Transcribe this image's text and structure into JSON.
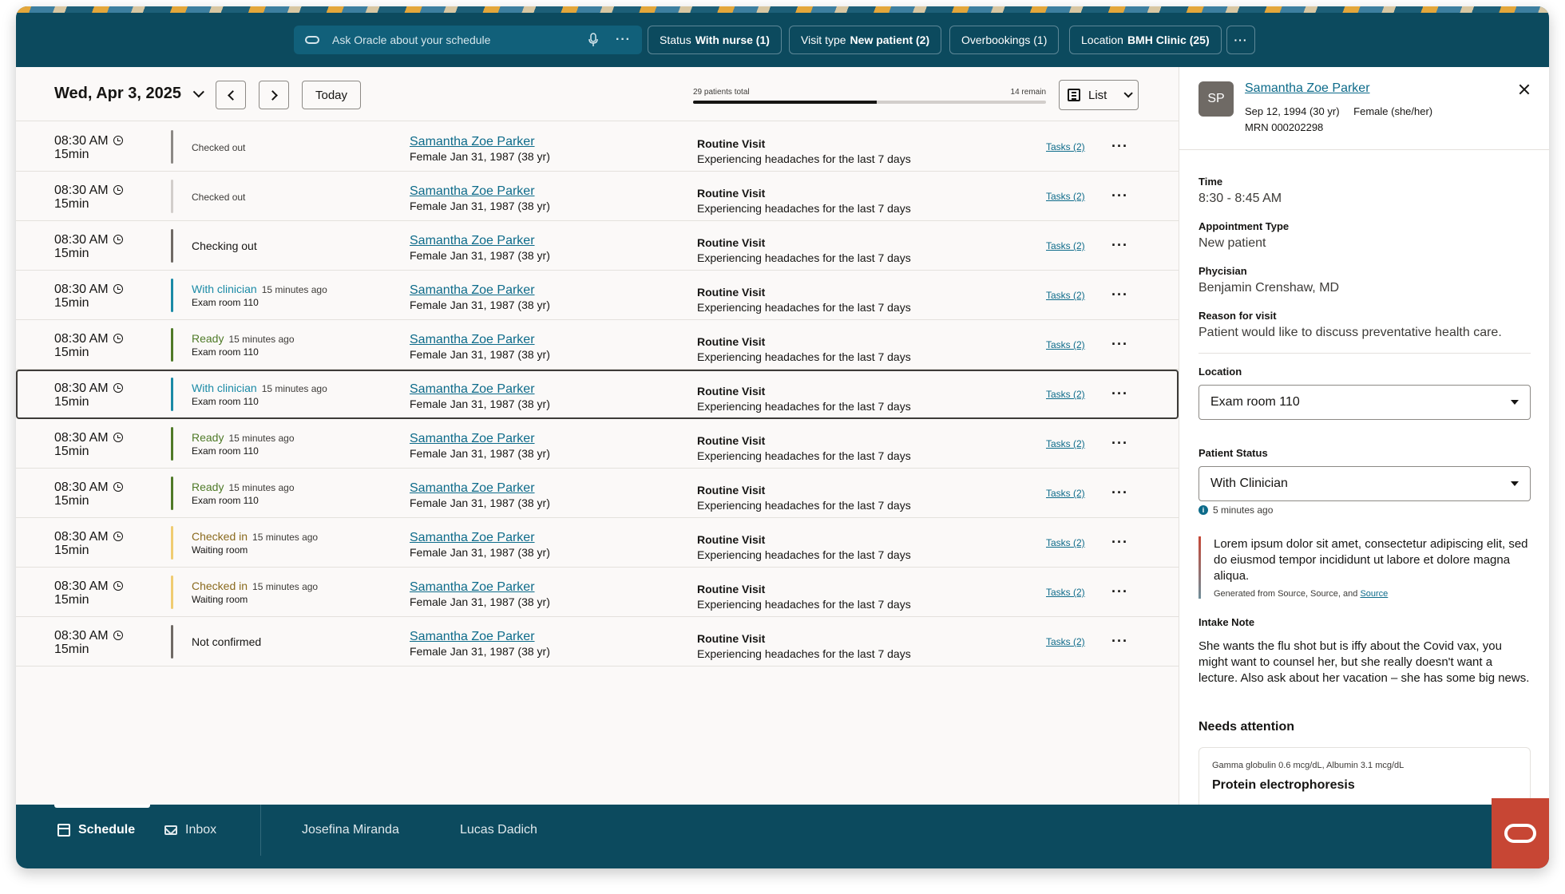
{
  "topbar": {
    "search_placeholder": "Ask Oracle about your schedule",
    "filters": [
      {
        "label": "Status",
        "value": "With nurse (1)"
      },
      {
        "label": "Visit type",
        "value": "New patient (2)"
      },
      {
        "label": "",
        "value": "Overbookings (1)"
      },
      {
        "label": "Location",
        "value": "BMH Clinic (25)"
      }
    ],
    "more_label": "···"
  },
  "toolbar": {
    "date": "Wed, Apr 3, 2025",
    "today_label": "Today",
    "patients_total": "29 patients total",
    "remain": "14 remain",
    "progress_fraction": 0.52,
    "view_label": "List"
  },
  "colors": {
    "primary": "#0c4a5e",
    "link": "#0d6b8a",
    "clinician": "#1a8aa6",
    "ready": "#4f7a28",
    "checked_in": "#f0cc71",
    "neutral_bar": "#8c8985",
    "oracle_red": "#c74634"
  },
  "rows": [
    {
      "time": "08:30 AM",
      "duration": "15min",
      "status": "Checked out",
      "status_style": "small",
      "bar": "#8c8985",
      "ago": "",
      "room": "",
      "patient": "Samantha Zoe Parker",
      "patient_meta": "Female   Jan 31, 1987 (38 yr)",
      "visit_type": "Routine Visit",
      "reason": "Experiencing headaches for the last 7 days",
      "tasks": "Tasks (2)",
      "selected": false
    },
    {
      "time": "08:30 AM",
      "duration": "15min",
      "status": "Checked out",
      "status_style": "small",
      "bar": "#d2cecb",
      "ago": "",
      "room": "",
      "patient": "Samantha Zoe Parker",
      "patient_meta": "Female   Jan 31, 1987 (38 yr)",
      "visit_type": "Routine Visit",
      "reason": "Experiencing headaches for the last 7 days",
      "tasks": "Tasks (2)",
      "selected": false
    },
    {
      "time": "08:30 AM",
      "duration": "15min",
      "status": "Checking out",
      "status_style": "plain",
      "bar": "#6f6a65",
      "ago": "",
      "room": "",
      "patient": "Samantha Zoe Parker",
      "patient_meta": "Female   Jan 31, 1987 (38 yr)",
      "visit_type": "Routine Visit",
      "reason": "Experiencing headaches for the last 7 days",
      "tasks": "Tasks (2)",
      "selected": false
    },
    {
      "time": "08:30 AM",
      "duration": "15min",
      "status": "With clinician",
      "status_style": "clinician",
      "bar": "#1a8aa6",
      "ago": "15 minutes ago",
      "room": "Exam room 110",
      "patient": "Samantha Zoe Parker",
      "patient_meta": "Female   Jan 31, 1987 (38 yr)",
      "visit_type": "Routine Visit",
      "reason": "Experiencing headaches for the last 7 days",
      "tasks": "Tasks (2)",
      "selected": false
    },
    {
      "time": "08:30 AM",
      "duration": "15min",
      "status": "Ready",
      "status_style": "ready",
      "bar": "#4f7a28",
      "ago": "15 minutes ago",
      "room": "Exam room 110",
      "patient": "Samantha Zoe Parker",
      "patient_meta": "Female   Jan 31, 1987 (38 yr)",
      "visit_type": "Routine Visit",
      "reason": "Experiencing headaches for the last 7 days",
      "tasks": "Tasks (2)",
      "selected": false
    },
    {
      "time": "08:30 AM",
      "duration": "15min",
      "status": "With clinician",
      "status_style": "clinician",
      "bar": "#1a8aa6",
      "ago": "15 minutes ago",
      "room": "Exam room 110",
      "patient": "Samantha Zoe Parker",
      "patient_meta": "Female   Jan 31, 1987 (38 yr)",
      "visit_type": "Routine Visit",
      "reason": "Experiencing headaches for the last 7 days",
      "tasks": "Tasks (2)",
      "selected": true
    },
    {
      "time": "08:30 AM",
      "duration": "15min",
      "status": "Ready",
      "status_style": "ready",
      "bar": "#4f7a28",
      "ago": "15 minutes ago",
      "room": "Exam room 110",
      "patient": "Samantha Zoe Parker",
      "patient_meta": "Female   Jan 31, 1987 (38 yr)",
      "visit_type": "Routine Visit",
      "reason": "Experiencing headaches for the last 7 days",
      "tasks": "Tasks (2)",
      "selected": false
    },
    {
      "time": "08:30 AM",
      "duration": "15min",
      "status": "Ready",
      "status_style": "ready",
      "bar": "#4f7a28",
      "ago": "15 minutes ago",
      "room": "Exam room 110",
      "patient": "Samantha Zoe Parker",
      "patient_meta": "Female   Jan 31, 1987 (38 yr)",
      "visit_type": "Routine Visit",
      "reason": "Experiencing headaches for the last 7 days",
      "tasks": "Tasks (2)",
      "selected": false
    },
    {
      "time": "08:30 AM",
      "duration": "15min",
      "status": "Checked in",
      "status_style": "checkedin",
      "bar": "#f0cc71",
      "ago": "15 minutes ago",
      "room": "Waiting room",
      "patient": "Samantha Zoe Parker",
      "patient_meta": "Female   Jan 31, 1987 (38 yr)",
      "visit_type": "Routine Visit",
      "reason": "Experiencing headaches for the last 7 days",
      "tasks": "Tasks (2)",
      "selected": false
    },
    {
      "time": "08:30 AM",
      "duration": "15min",
      "status": "Checked in",
      "status_style": "checkedin",
      "bar": "#f0cc71",
      "ago": "15 minutes ago",
      "room": "Waiting room",
      "patient": "Samantha Zoe Parker",
      "patient_meta": "Female   Jan 31, 1987 (38 yr)",
      "visit_type": "Routine Visit",
      "reason": "Experiencing headaches for the last 7 days",
      "tasks": "Tasks (2)",
      "selected": false
    },
    {
      "time": "08:30 AM",
      "duration": "15min",
      "status": "Not confirmed",
      "status_style": "plain",
      "bar": "#6f6a65",
      "ago": "",
      "room": "",
      "patient": "Samantha Zoe Parker",
      "patient_meta": "Female   Jan 31, 1987 (38 yr)",
      "visit_type": "Routine Visit",
      "reason": "Experiencing headaches for the last 7 days",
      "tasks": "Tasks (2)",
      "selected": false
    }
  ],
  "detail": {
    "initials": "SP",
    "name": "Samantha Zoe Parker",
    "dob": "Sep 12, 1994 (30 yr)",
    "gender": "Female (she/her)",
    "mrn": "MRN 000202298",
    "time_label": "Time",
    "time_value": "8:30 - 8:45 AM",
    "appt_label": "Appointment Type",
    "appt_value": "New patient",
    "physician_label": "Phycisian",
    "physician_value": "Benjamin Crenshaw, MD",
    "reason_label": "Reason for visit",
    "reason_value": "Patient would like to discuss preventative health care.",
    "location_label": "Location",
    "location_value": "Exam room 110",
    "status_label": "Patient Status",
    "status_value": "With Clinician",
    "status_time": "5 minutes ago",
    "ai_text": "Lorem ipsum dolor sit amet, consectetur adipiscing elit, sed do eiusmod tempor incididunt ut labore et dolore magna aliqua.",
    "ai_source_prefix": "Generated from Source, Source, and ",
    "ai_source_link": "Source",
    "intake_label": "Intake Note",
    "intake_text": "She wants the flu shot but is iffy about the Covid vax, you might want to counsel her, but she really doesn't want a lecture. Also ask about her vacation – she has some big news.",
    "needs_title": "Needs attention",
    "attn_sub": "Gamma globulin 0.6 mcg/dL, Albumin 3.1 mcg/dL",
    "attn_title": "Protein electrophoresis"
  },
  "bottomnav": {
    "schedule": "Schedule",
    "inbox": "Inbox",
    "user1": "Josefina Miranda",
    "user2": "Lucas Dadich"
  }
}
